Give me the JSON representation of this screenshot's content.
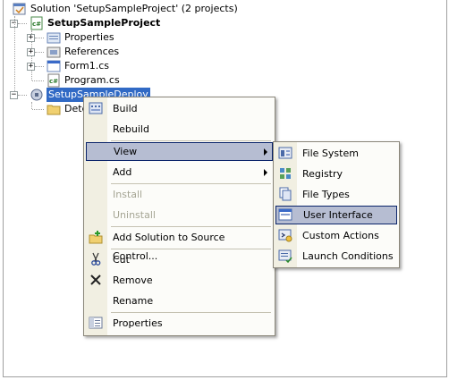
{
  "tree": {
    "solution": "Solution 'SetupSampleProject' (2 projects)",
    "project": "SetupSampleProject",
    "items": [
      "Properties",
      "References",
      "Form1.cs",
      "Program.cs"
    ],
    "deploy": "SetupSampleDeploy",
    "detected": "Dete"
  },
  "context_menu": {
    "build": "Build",
    "rebuild": "Rebuild",
    "view": "View",
    "add": "Add",
    "install": "Install",
    "uninstall": "Uninstall",
    "source_control": "Add Solution to Source Control...",
    "cut": "Cut",
    "remove": "Remove",
    "rename": "Rename",
    "properties": "Properties"
  },
  "view_submenu": {
    "file_system": "File System",
    "registry": "Registry",
    "file_types": "File Types",
    "user_interface": "User Interface",
    "custom_actions": "Custom Actions",
    "launch_conditions": "Launch Conditions"
  },
  "colors": {
    "selection": "#316ac5",
    "menu_highlight": "#b6bdd2",
    "menu_highlight_border": "#0a246a"
  }
}
